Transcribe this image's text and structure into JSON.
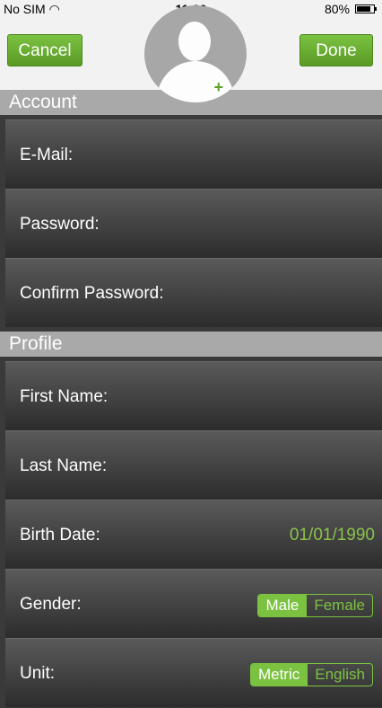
{
  "status_bar": {
    "carrier": "No SIM",
    "time": "11:30",
    "battery": "80%",
    "wifi_icon": "wifi-icon"
  },
  "nav": {
    "cancel_label": "Cancel",
    "done_label": "Done",
    "avatar_plus": "+"
  },
  "sections": {
    "account": "Account",
    "profile": "Profile"
  },
  "fields": {
    "email_label": "E-Mail:",
    "password_label": "Password:",
    "confirm_password_label": "Confirm Password:",
    "first_name_label": "First Name:",
    "last_name_label": "Last Name:",
    "birth_date_label": "Birth Date:",
    "birth_date_value": "01/01/1990",
    "gender_label": "Gender:",
    "gender_options": [
      "Male",
      "Female"
    ],
    "gender_selected": "Male",
    "unit_label": "Unit:",
    "unit_options": [
      "Metric",
      "English"
    ],
    "unit_selected": "Metric"
  },
  "colors": {
    "accent": "#7cc241",
    "section_header": "#a9a9a9",
    "row_background": "#3a3a3a"
  }
}
